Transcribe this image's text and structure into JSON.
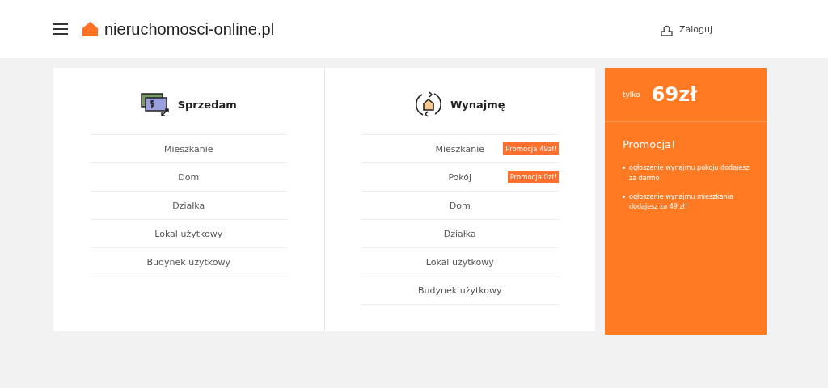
{
  "header": {
    "logo": "nieruchomosci-online.pl",
    "login": "Zaloguj"
  },
  "sections": [
    {
      "kind": "sale",
      "title": "Sprzedam",
      "items": [
        {
          "label": "Mieszkanie"
        },
        {
          "label": "Dom"
        },
        {
          "label": "Działka"
        },
        {
          "label": "Lokal użytkowy"
        },
        {
          "label": "Budynek użytkowy"
        }
      ]
    },
    {
      "kind": "rent",
      "title": "Wynajmę",
      "items": [
        {
          "label": "Mieszkanie",
          "badge": "Promocja 49zł!"
        },
        {
          "label": "Pokój",
          "badge": "Promocja 0zł!"
        },
        {
          "label": "Dom"
        },
        {
          "label": "Działka"
        },
        {
          "label": "Lokal użytkowy"
        },
        {
          "label": "Budynek użytkowy"
        }
      ]
    }
  ],
  "promo": {
    "prefix": "tylko",
    "price": "69zł",
    "title": "Promocja!",
    "points": [
      "ogłoszenie wynajmu pokoju dodajesz za darmo",
      "ogłoszenie wynajmu mieszkania dodajesz za 49 zł!"
    ]
  }
}
